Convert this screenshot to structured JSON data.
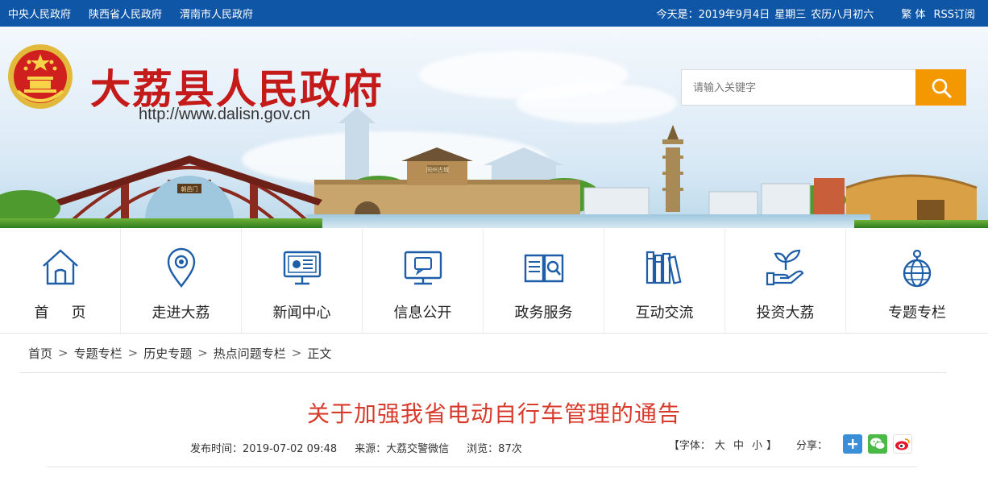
{
  "topbar": {
    "links": [
      "中央人民政府",
      "陕西省人民政府",
      "渭南市人民政府"
    ],
    "date_text": "今天是：2019年9月4日",
    "weekday": "星期三",
    "lunar": "农历八月初六",
    "traditional": "繁 体",
    "rss": "RSS订阅"
  },
  "header": {
    "site_title": "大荔县人民政府",
    "site_url": "http://www.dalisn.gov.cn",
    "search_placeholder": "请输入关键字",
    "colors": {
      "title": "#c51a1a",
      "search_button": "#f39800",
      "topbar": "#1056a6"
    }
  },
  "banner_signs": {
    "arch_plaque": "朝邑门",
    "building_plaque": "同州古城"
  },
  "nav": {
    "items": [
      {
        "label": "首页",
        "icon": "house-icon"
      },
      {
        "label": "走进大荔",
        "icon": "location-pin-icon"
      },
      {
        "label": "新闻中心",
        "icon": "monitor-news-icon"
      },
      {
        "label": "信息公开",
        "icon": "monitor-chat-icon"
      },
      {
        "label": "政务服务",
        "icon": "document-search-icon"
      },
      {
        "label": "互动交流",
        "icon": "books-icon"
      },
      {
        "label": "投资大荔",
        "icon": "hand-sprout-icon"
      },
      {
        "label": "专题专栏",
        "icon": "globe-icon"
      }
    ]
  },
  "breadcrumb": {
    "items": [
      "首页",
      "专题专栏",
      "历史专题",
      "热点问题专栏",
      "正文"
    ],
    "separator": ">"
  },
  "article": {
    "title": "关于加强我省电动自行车管理的通告",
    "publish_time": "发布时间：2019-07-02 09:48",
    "source": "来源：大荔交警微信",
    "views": "浏览：87次",
    "font_size_prefix": "【字体：",
    "font_sizes": [
      "大",
      "中",
      "小"
    ],
    "font_size_suffix": "】",
    "share_label": "分享："
  }
}
